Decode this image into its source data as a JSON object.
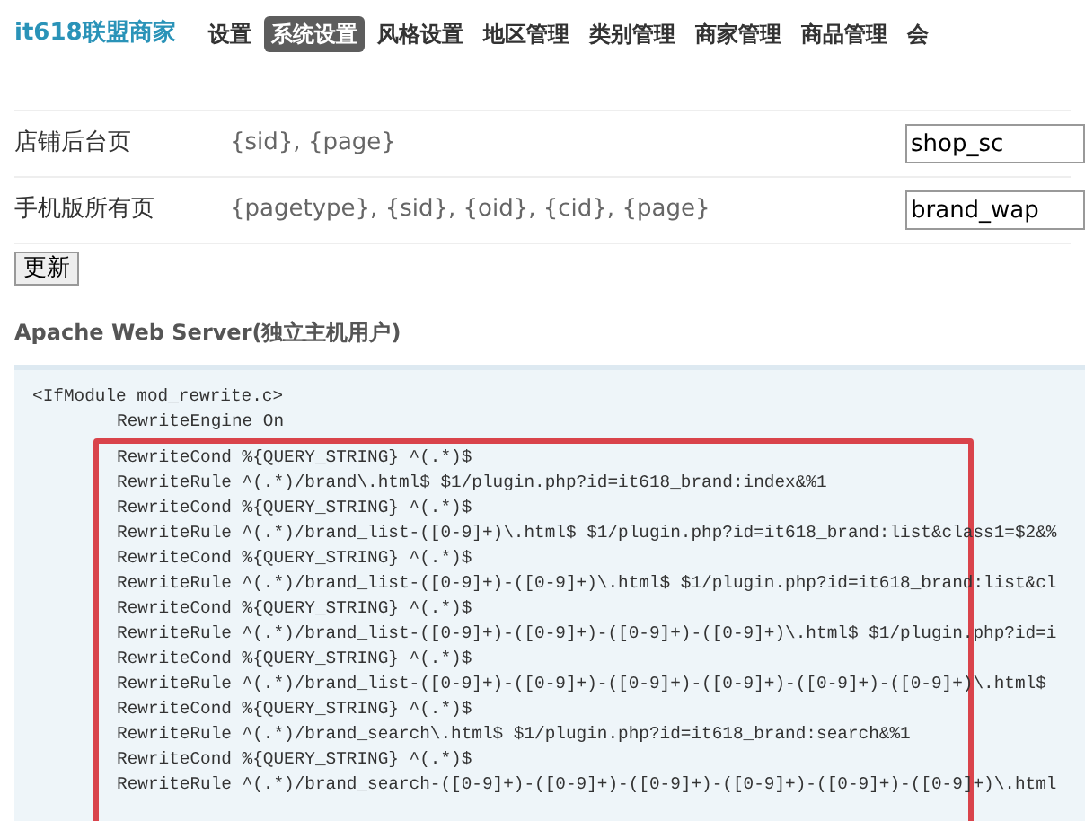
{
  "header": {
    "logo": "it618联盟商家",
    "nav": [
      {
        "label": "设置",
        "selected": false
      },
      {
        "label": "系统设置",
        "selected": true
      },
      {
        "label": "风格设置",
        "selected": false
      },
      {
        "label": "地区管理",
        "selected": false
      },
      {
        "label": "类别管理",
        "selected": false
      },
      {
        "label": "商家管理",
        "selected": false
      },
      {
        "label": "商品管理",
        "selected": false
      },
      {
        "label": "会",
        "selected": false
      }
    ]
  },
  "rows": [
    {
      "label": "店铺后台页",
      "vars": "{sid}, {page}",
      "value": "shop_sc"
    },
    {
      "label": "手机版所有页",
      "vars": "{pagetype}, {sid}, {oid}, {cid}, {page}",
      "value": "brand_wap"
    }
  ],
  "submit_button": "更新",
  "section_title": "Apache Web Server(独立主机用户)",
  "code": {
    "open": "<IfModule mod_rewrite.c>",
    "lines": [
      "RewriteEngine On"
    ],
    "highlighted": [
      "RewriteCond %{QUERY_STRING} ^(.*)$",
      "RewriteRule ^(.*)/brand\\.html$ $1/plugin.php?id=it618_brand:index&%1",
      "RewriteCond %{QUERY_STRING} ^(.*)$",
      "RewriteRule ^(.*)/brand_list-([0-9]+)\\.html$ $1/plugin.php?id=it618_brand:list&class1=$2&%",
      "RewriteCond %{QUERY_STRING} ^(.*)$",
      "RewriteRule ^(.*)/brand_list-([0-9]+)-([0-9]+)\\.html$ $1/plugin.php?id=it618_brand:list&cl",
      "RewriteCond %{QUERY_STRING} ^(.*)$",
      "RewriteRule ^(.*)/brand_list-([0-9]+)-([0-9]+)-([0-9]+)-([0-9]+)\\.html$ $1/plugin.php?id=i",
      "RewriteCond %{QUERY_STRING} ^(.*)$",
      "RewriteRule ^(.*)/brand_list-([0-9]+)-([0-9]+)-([0-9]+)-([0-9]+)-([0-9]+)-([0-9]+)\\.html$",
      "RewriteCond %{QUERY_STRING} ^(.*)$",
      "RewriteRule ^(.*)/brand_search\\.html$ $1/plugin.php?id=it618_brand:search&%1",
      "RewriteCond %{QUERY_STRING} ^(.*)$",
      "RewriteRule ^(.*)/brand_search-([0-9]+)-([0-9]+)-([0-9]+)-([0-9]+)-([0-9]+)-([0-9]+)\\.html"
    ]
  }
}
